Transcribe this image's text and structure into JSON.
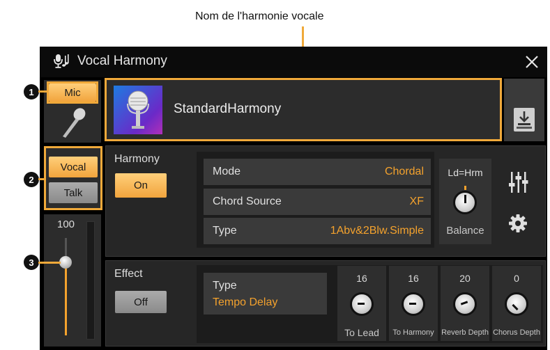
{
  "callout": {
    "title": "Nom de l'harmonie vocale"
  },
  "badges": [
    "1",
    "2",
    "3"
  ],
  "window": {
    "title": "Vocal Harmony",
    "close_icon": "close-icon"
  },
  "left": {
    "mic_label": "Mic",
    "vocal_label": "Vocal",
    "talk_label": "Talk",
    "level_max": "100",
    "level_value": 0.82
  },
  "harmony_name": {
    "name": "StandardHarmony"
  },
  "harmony": {
    "section_label": "Harmony",
    "toggle_label": "On",
    "rows": [
      {
        "label": "Mode",
        "value": "Chordal"
      },
      {
        "label": "Chord Source",
        "value": "XF"
      },
      {
        "label": "Type",
        "value": "1Abv&2Blw.Simple"
      }
    ],
    "balance_top": "Ld=Hrm",
    "balance_label": "Balance"
  },
  "effect": {
    "section_label": "Effect",
    "toggle_label": "Off",
    "type_label": "Type",
    "type_value": "Tempo Delay",
    "knobs": [
      {
        "value": "16",
        "label": "To Lead"
      },
      {
        "value": "16",
        "label": "To Harmony"
      },
      {
        "value": "20",
        "label": "Reverb Depth"
      },
      {
        "value": "0",
        "label": "Chorus Depth"
      }
    ]
  },
  "colors": {
    "accent": "#f4a22d",
    "frame": "#f0a93a",
    "background": "#000000"
  }
}
